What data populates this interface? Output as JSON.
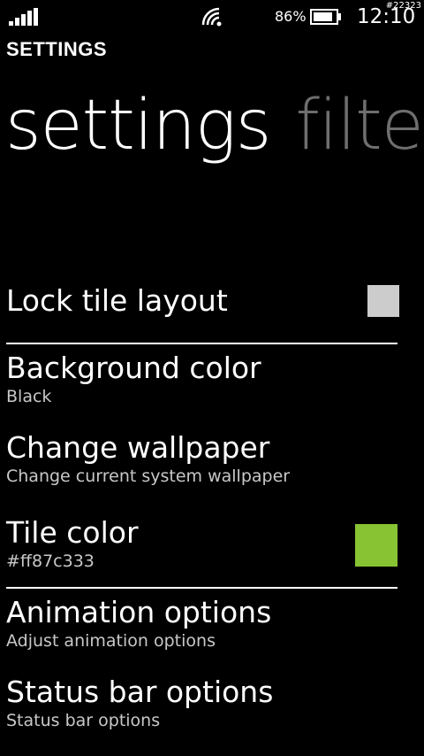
{
  "status_bar": {
    "battery_percent": "86%",
    "time": "12:10",
    "overlay_tag": "#22323"
  },
  "header": {
    "app_title": "SETTINGS",
    "pivots": [
      {
        "label": "settings",
        "active": true
      },
      {
        "label": "filters",
        "active": false
      }
    ]
  },
  "settings": {
    "lock_tile_layout": {
      "title": "Lock tile layout",
      "checked": false
    },
    "background_color": {
      "title": "Background color",
      "subtitle": "Black"
    },
    "change_wallpaper": {
      "title": "Change wallpaper",
      "subtitle": "Change current system wallpaper"
    },
    "tile_color": {
      "title": "Tile color",
      "subtitle": "#ff87c333",
      "swatch_color": "#87c333"
    },
    "animation_options": {
      "title": "Animation options",
      "subtitle": "Adjust animation options"
    },
    "status_bar_options": {
      "title": "Status bar options",
      "subtitle": "Status bar options"
    }
  },
  "colors": {
    "background": "#000000",
    "text": "#ffffff",
    "subtext": "#c8c8c8",
    "inactive_pivot": "#6e6e6e",
    "checkbox": "#cccccc",
    "tile_accent": "#87c333"
  }
}
